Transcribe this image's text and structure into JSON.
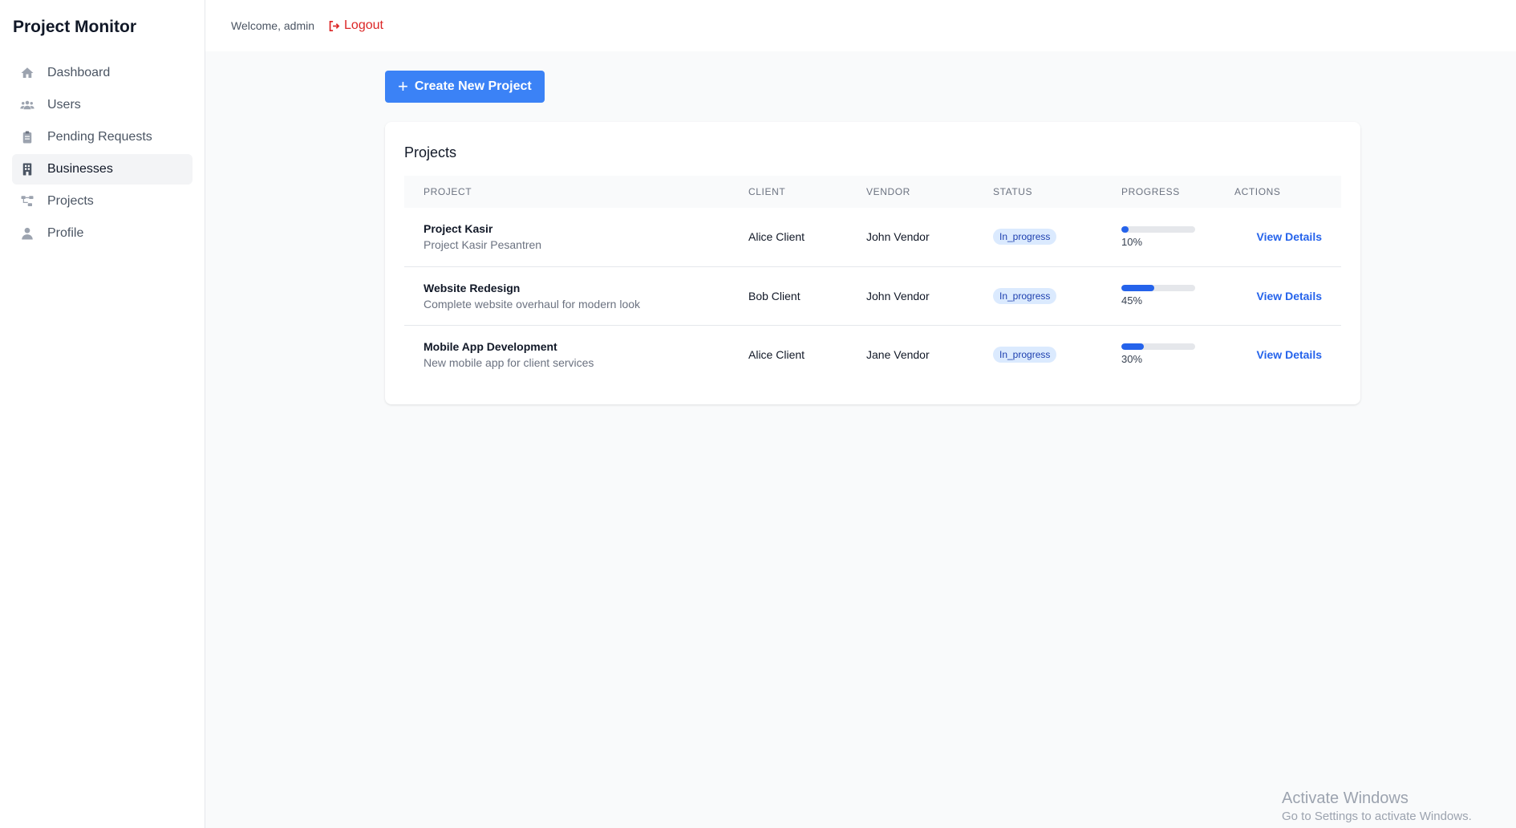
{
  "app": {
    "title": "Project Monitor"
  },
  "sidebar": {
    "items": [
      {
        "label": "Dashboard",
        "icon": "home-icon"
      },
      {
        "label": "Users",
        "icon": "users-icon"
      },
      {
        "label": "Pending Requests",
        "icon": "clipboard-icon"
      },
      {
        "label": "Businesses",
        "icon": "building-icon",
        "active": true
      },
      {
        "label": "Projects",
        "icon": "sitemap-icon"
      },
      {
        "label": "Profile",
        "icon": "user-icon"
      }
    ]
  },
  "topbar": {
    "welcome": "Welcome, admin",
    "logout_label": "Logout"
  },
  "main": {
    "create_button_label": "Create New Project",
    "card_title": "Projects"
  },
  "table": {
    "headers": [
      "PROJECT",
      "CLIENT",
      "VENDOR",
      "STATUS",
      "PROGRESS",
      "ACTIONS"
    ],
    "rows": [
      {
        "name": "Project Kasir",
        "desc": "Project Kasir Pesantren",
        "client": "Alice Client",
        "vendor": "John Vendor",
        "status": "In_progress",
        "progress": 10,
        "progress_label": "10%",
        "action": "View Details"
      },
      {
        "name": "Website Redesign",
        "desc": "Complete website overhaul for modern look",
        "client": "Bob Client",
        "vendor": "John Vendor",
        "status": "In_progress",
        "progress": 45,
        "progress_label": "45%",
        "action": "View Details"
      },
      {
        "name": "Mobile App Development",
        "desc": "New mobile app for client services",
        "client": "Alice Client",
        "vendor": "Jane Vendor",
        "status": "In_progress",
        "progress": 30,
        "progress_label": "30%",
        "action": "View Details"
      }
    ]
  },
  "watermark": {
    "title": "Activate Windows",
    "subtitle": "Go to Settings to activate Windows."
  },
  "colors": {
    "accent": "#3b82f6",
    "progress": "#2563eb",
    "logout": "#dc2626",
    "badge_bg": "#dbeafe",
    "badge_text": "#1e40af"
  }
}
